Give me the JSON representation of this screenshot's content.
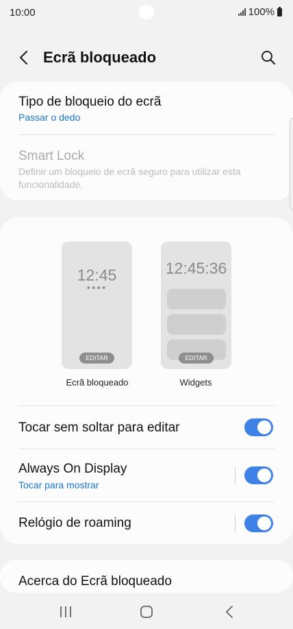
{
  "status_bar": {
    "time": "10:00",
    "battery": "100%"
  },
  "header": {
    "title": "Ecrã bloqueado"
  },
  "lock_type": {
    "title": "Tipo de bloqueio do ecrã",
    "value": "Passar o dedo"
  },
  "smart_lock": {
    "title": "Smart Lock",
    "subtitle": "Definir um bloqueio de ecrã seguro para utilizar esta funcionalidade."
  },
  "previews": {
    "lock_screen": {
      "clock": "12:45",
      "dots": "●●●●",
      "edit": "EDITAR",
      "label": "Ecrã bloqueado"
    },
    "widgets": {
      "clock": "12:45:36",
      "edit": "EDITAR",
      "label": "Widgets"
    }
  },
  "settings": {
    "touch_hold": {
      "title": "Tocar sem soltar para editar",
      "enabled": true
    },
    "aod": {
      "title": "Always On Display",
      "subtitle": "Tocar para mostrar",
      "enabled": true
    },
    "roaming_clock": {
      "title": "Relógio de roaming",
      "enabled": true
    }
  },
  "about": {
    "title": "Acerca do Ecrã bloqueado"
  },
  "colors": {
    "accent": "#3f82e5",
    "link": "#1976c8",
    "background": "#f2f2f2",
    "card": "#fcfcfc"
  },
  "icons": {
    "back": "chevron-left-icon",
    "search": "search-icon",
    "recents": "recents-icon",
    "home": "home-icon",
    "nav_back": "nav-back-icon"
  }
}
